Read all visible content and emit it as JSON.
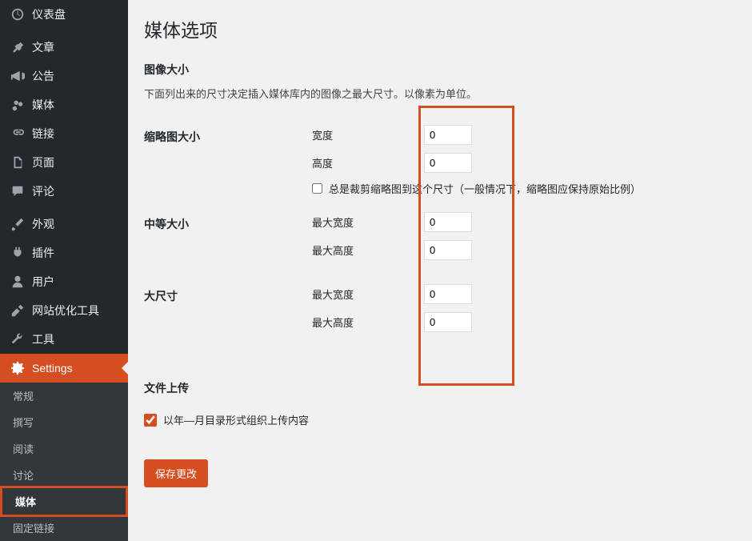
{
  "sidebar": {
    "items": [
      {
        "label": "仪表盘"
      },
      {
        "label": "文章"
      },
      {
        "label": "公告"
      },
      {
        "label": "媒体"
      },
      {
        "label": "链接"
      },
      {
        "label": "页面"
      },
      {
        "label": "评论"
      },
      {
        "label": "外观"
      },
      {
        "label": "插件"
      },
      {
        "label": "用户"
      },
      {
        "label": "网站优化工具"
      },
      {
        "label": "工具"
      },
      {
        "label": "Settings"
      }
    ],
    "subitems": [
      {
        "label": "常规"
      },
      {
        "label": "撰写"
      },
      {
        "label": "阅读"
      },
      {
        "label": "讨论"
      },
      {
        "label": "媒体"
      },
      {
        "label": "固定链接"
      }
    ]
  },
  "page": {
    "title": "媒体选项",
    "section_image_size": "图像大小",
    "section_image_desc": "下面列出来的尺寸决定插入媒体库内的图像之最大尺寸。以像素为单位。",
    "thumbnail": {
      "label": "缩略图大小",
      "width_label": "宽度",
      "width_value": "0",
      "height_label": "高度",
      "height_value": "0",
      "crop_label": "总是裁剪缩略图到这个尺寸（一般情况下，缩略图应保持原始比例）"
    },
    "medium": {
      "label": "中等大小",
      "max_width_label": "最大宽度",
      "max_width_value": "0",
      "max_height_label": "最大高度",
      "max_height_value": "0"
    },
    "large": {
      "label": "大尺寸",
      "max_width_label": "最大宽度",
      "max_width_value": "0",
      "max_height_label": "最大高度",
      "max_height_value": "0"
    },
    "upload_section": "文件上传",
    "upload_check_label": "以年—月目录形式组织上传内容",
    "save_button": "保存更改"
  }
}
